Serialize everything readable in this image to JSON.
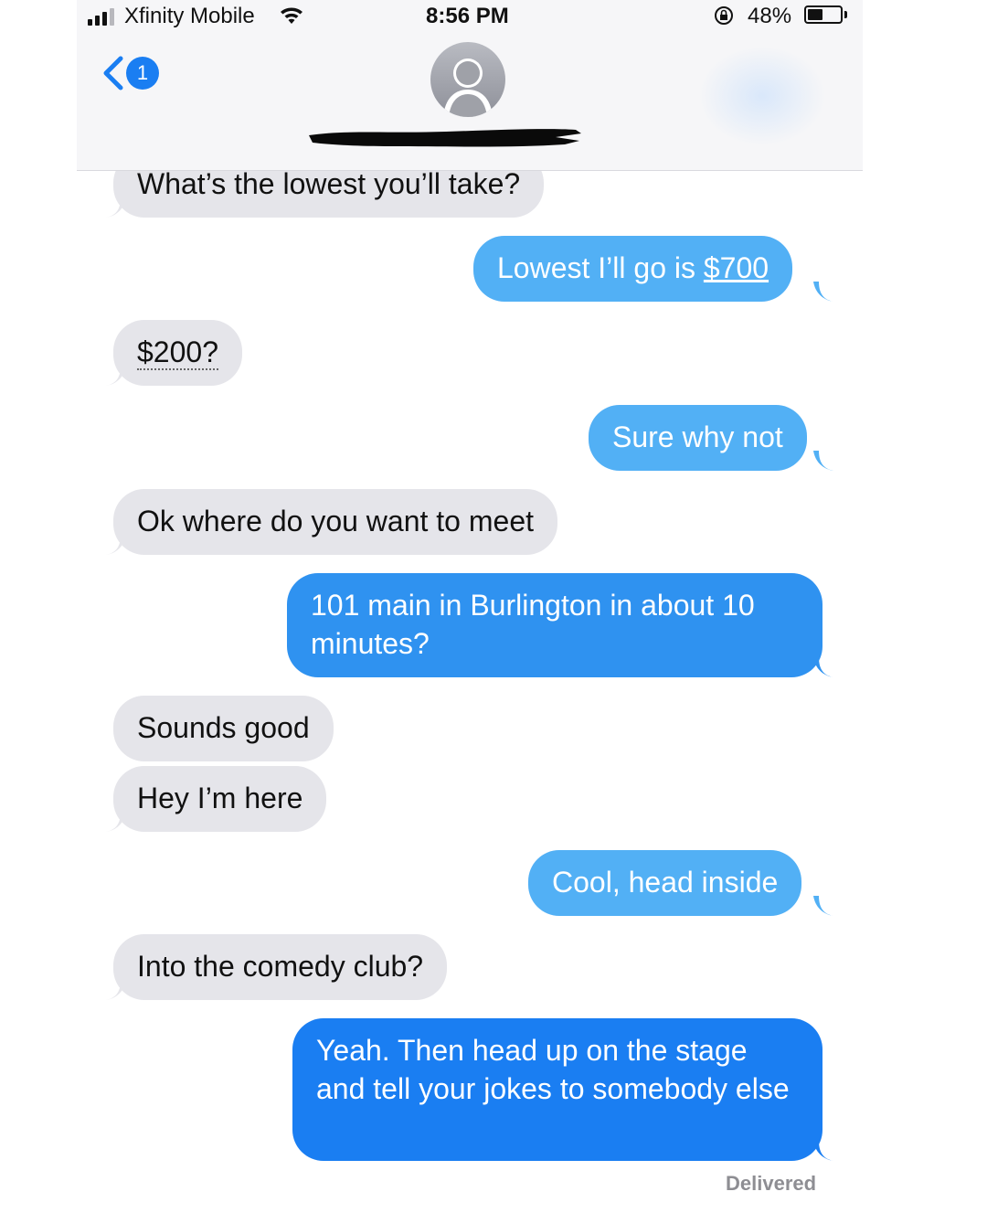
{
  "status_bar": {
    "carrier": "Xfinity Mobile",
    "time": "8:56 PM",
    "battery_percent": "48%",
    "battery_level": 0.48,
    "icons": [
      "signal-icon",
      "wifi-icon",
      "rotation-lock-icon",
      "battery-icon"
    ]
  },
  "header": {
    "back_badge_count": "1",
    "contact_name_redacted": true
  },
  "colors": {
    "incoming_bubble": "#e5e5ea",
    "outgoing_bubble_light": "#52b0f5",
    "outgoing_bubble_dark": "#1a7ef2",
    "header_bg": "#f6f6f8"
  },
  "messages": [
    {
      "direction": "in",
      "text": "What’s the lowest you’ll take?"
    },
    {
      "direction": "out",
      "text_prefix": "Lowest I’ll go is ",
      "text_link": "$700"
    },
    {
      "direction": "in",
      "text": "$200?"
    },
    {
      "direction": "out",
      "text": "Sure why not"
    },
    {
      "direction": "in",
      "text": "Ok where do you want to meet"
    },
    {
      "direction": "out",
      "text": "101 main in Burlington in about 10 minutes?"
    },
    {
      "direction": "in",
      "text": "Sounds good"
    },
    {
      "direction": "in",
      "text": "Hey I’m here"
    },
    {
      "direction": "out",
      "text": "Cool, head inside"
    },
    {
      "direction": "in",
      "text": "Into the comedy club?"
    },
    {
      "direction": "out",
      "text": "Yeah. Then head up on the stage and tell your jokes to somebody else"
    }
  ],
  "status_label": "Delivered"
}
